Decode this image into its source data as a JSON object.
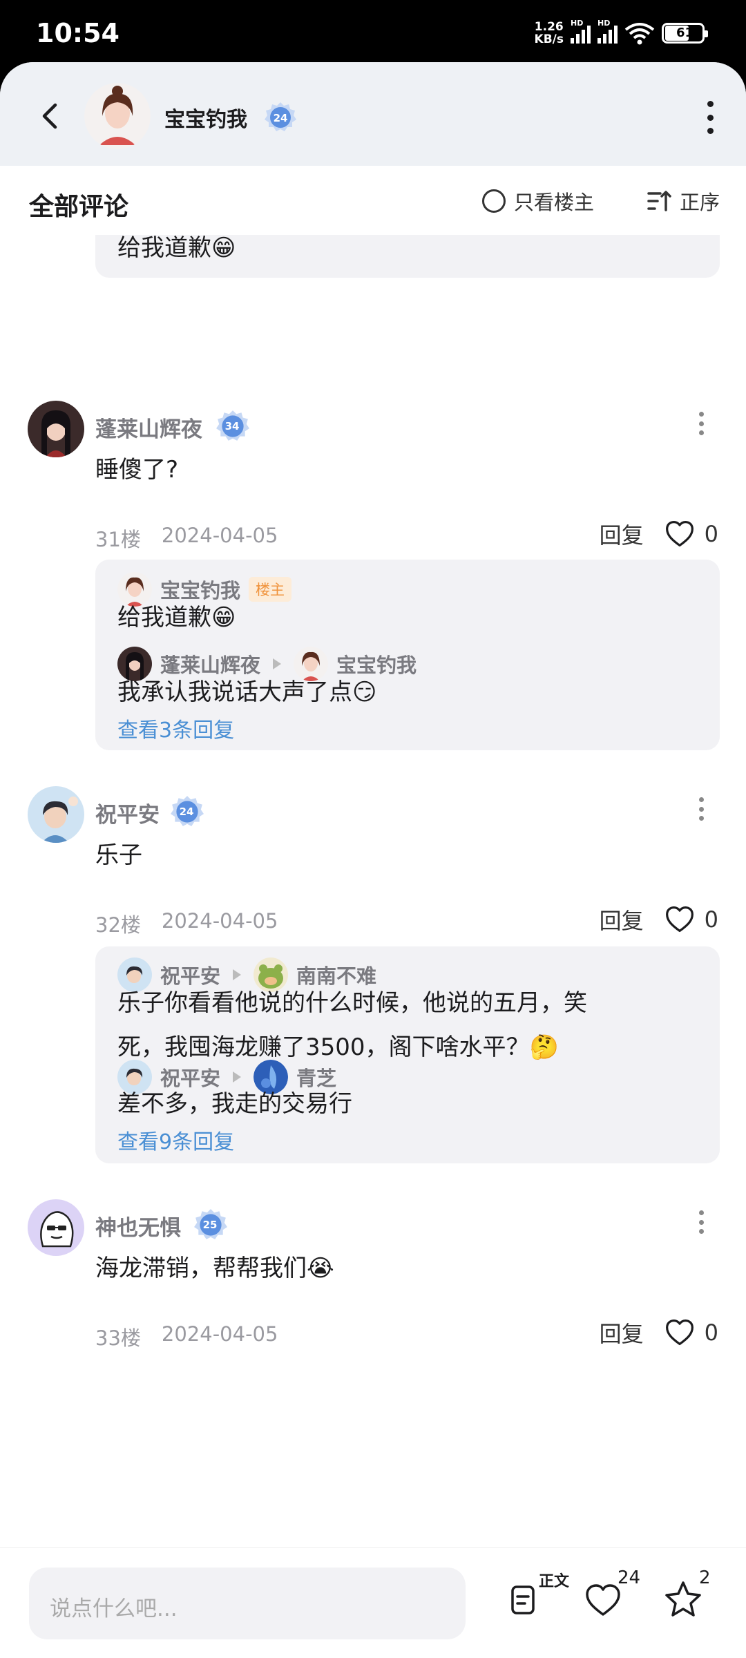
{
  "status_bar": {
    "time": "10:54",
    "net_speed_value": "1.26",
    "net_speed_unit": "KB/s",
    "sim1": "HD",
    "sim2": "HD",
    "battery": "61"
  },
  "header": {
    "author_name": "宝宝钓我",
    "author_level": "24"
  },
  "tabs": {
    "title": "全部评论",
    "only_host": "只看楼主",
    "sort": "正序"
  },
  "partial_top": {
    "text": "给我道歉😁"
  },
  "comments": [
    {
      "name": "蓬莱山辉夜",
      "level": "34",
      "text": "睡傻了?",
      "floor": "31楼",
      "date": "2024-04-05",
      "reply_label": "回复",
      "likes": "0",
      "replies": [
        {
          "from": "宝宝钓我",
          "tag": "楼主",
          "text": "给我道歉😁"
        },
        {
          "from": "蓬莱山辉夜",
          "to": "宝宝钓我",
          "text": "我承认我说话大声了点😏"
        }
      ],
      "more": "查看3条回复"
    },
    {
      "name": "祝平安",
      "level": "24",
      "text": "乐子",
      "floor": "32楼",
      "date": "2024-04-05",
      "reply_label": "回复",
      "likes": "0",
      "replies": [
        {
          "from": "祝平安",
          "to": "南南不难",
          "text_line1": "乐子你看看他说的什么时候，他说的五月，笑",
          "text_line2": "死，我囤海龙赚了3500，阁下啥水平？🤔"
        },
        {
          "from": "祝平安",
          "to": "青芝",
          "text": "差不多，我走的交易行"
        }
      ],
      "more": "查看9条回复"
    },
    {
      "name": "神也无惧",
      "level": "25",
      "text": "海龙滞销，帮帮我们😭",
      "floor": "33楼",
      "date": "2024-04-05",
      "reply_label": "回复",
      "likes": "0"
    }
  ],
  "bottom_bar": {
    "placeholder": "说点什么吧...",
    "doc_label": "正文",
    "like_count": "24",
    "star_count": "2"
  },
  "icons": {
    "back": "back-arrow-icon",
    "more": "more-vertical-icon",
    "sort": "sort-icon",
    "heart": "heart-icon",
    "star": "star-icon",
    "doc": "document-icon"
  },
  "colors": {
    "link": "#4a8fd4",
    "host_tag": "#f0933c",
    "level_badge": "#5b8fe0",
    "reply_bg": "#f2f2f5"
  }
}
